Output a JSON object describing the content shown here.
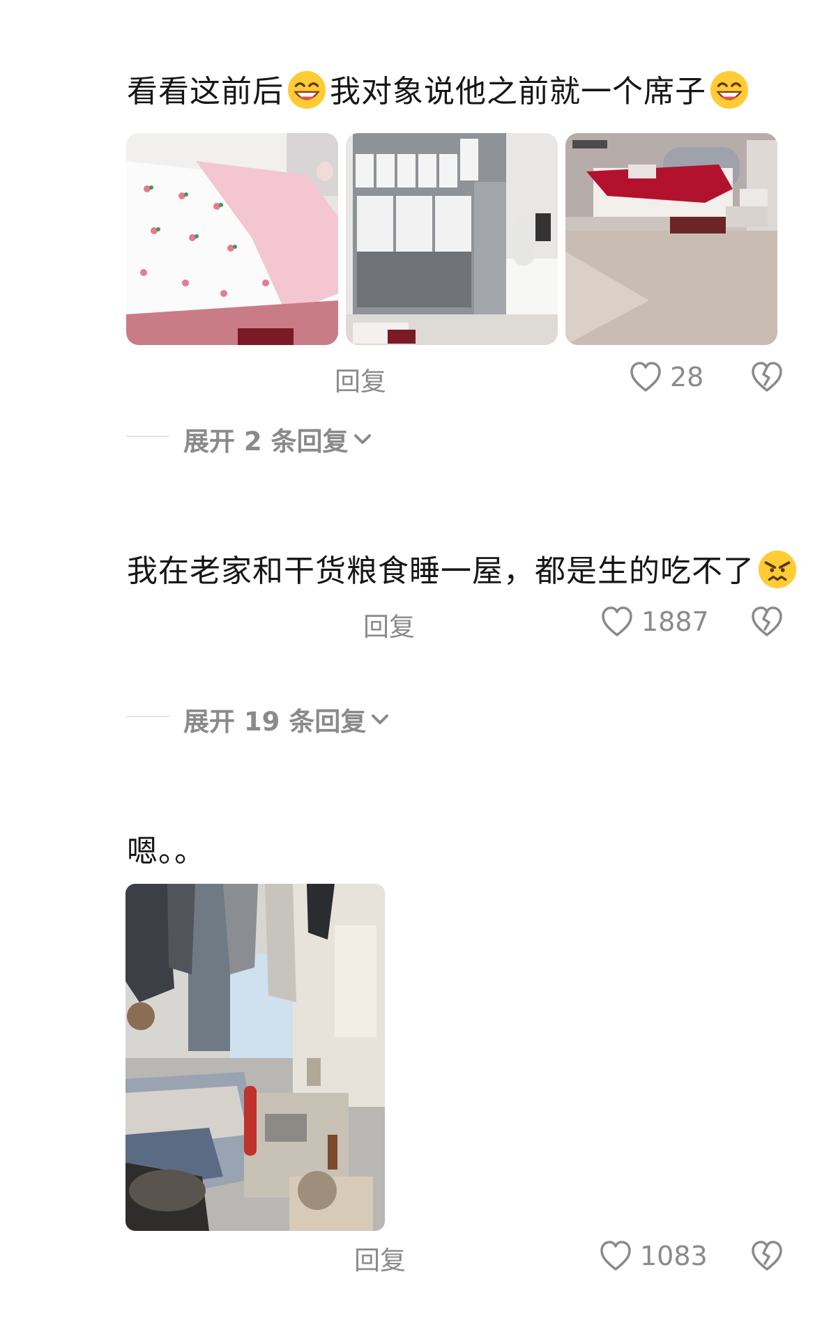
{
  "comments": [
    {
      "text_parts": [
        "看看这前后",
        "我对象说他之前就一个席子"
      ],
      "emojis": [
        "grinning-sweat-emoji",
        "grinning-sweat-emoji"
      ],
      "images": [
        "bed-with-pink-quilt-photo",
        "grey-wardrobe-photo",
        "bedroom-with-red-bedding-photo"
      ],
      "reply_label": "回复",
      "likes": "28",
      "expand_label": "展开 2 条回复"
    },
    {
      "text": "我在老家和干货粮食睡一屋，都是生的吃不了",
      "emoji": "angry-face-emoji",
      "reply_label": "回复",
      "likes": "1887",
      "expand_label": "展开 19 条回复"
    },
    {
      "text": "嗯。。",
      "images": [
        "cramped-room-with-laundry-photo"
      ],
      "reply_label": "回复",
      "likes": "1083"
    }
  ],
  "icons": {
    "like": "heart-outline-icon",
    "dislike": "broken-heart-icon",
    "expand": "chevron-down-icon"
  },
  "colors": {
    "text": "#161616",
    "muted": "#8a8a8a"
  }
}
